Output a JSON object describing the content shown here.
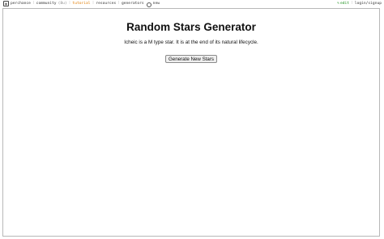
{
  "topbar": {
    "nav": {
      "perchance": "perchance",
      "community": "community",
      "community_count": "(8u)",
      "tutorial": "tutorial",
      "resources": "resources",
      "generators": "generators",
      "new": "new"
    },
    "edit_label": "edit",
    "login_label": "login/signup"
  },
  "main": {
    "title": "Random Stars Generator",
    "description": "Icheic is a M type star. It is at the end of its natural lifecycle.",
    "button_label": "Generate New Stars"
  },
  "colors": {
    "accent_orange": "#e07b00",
    "edit_green": "#1a8f1a"
  }
}
